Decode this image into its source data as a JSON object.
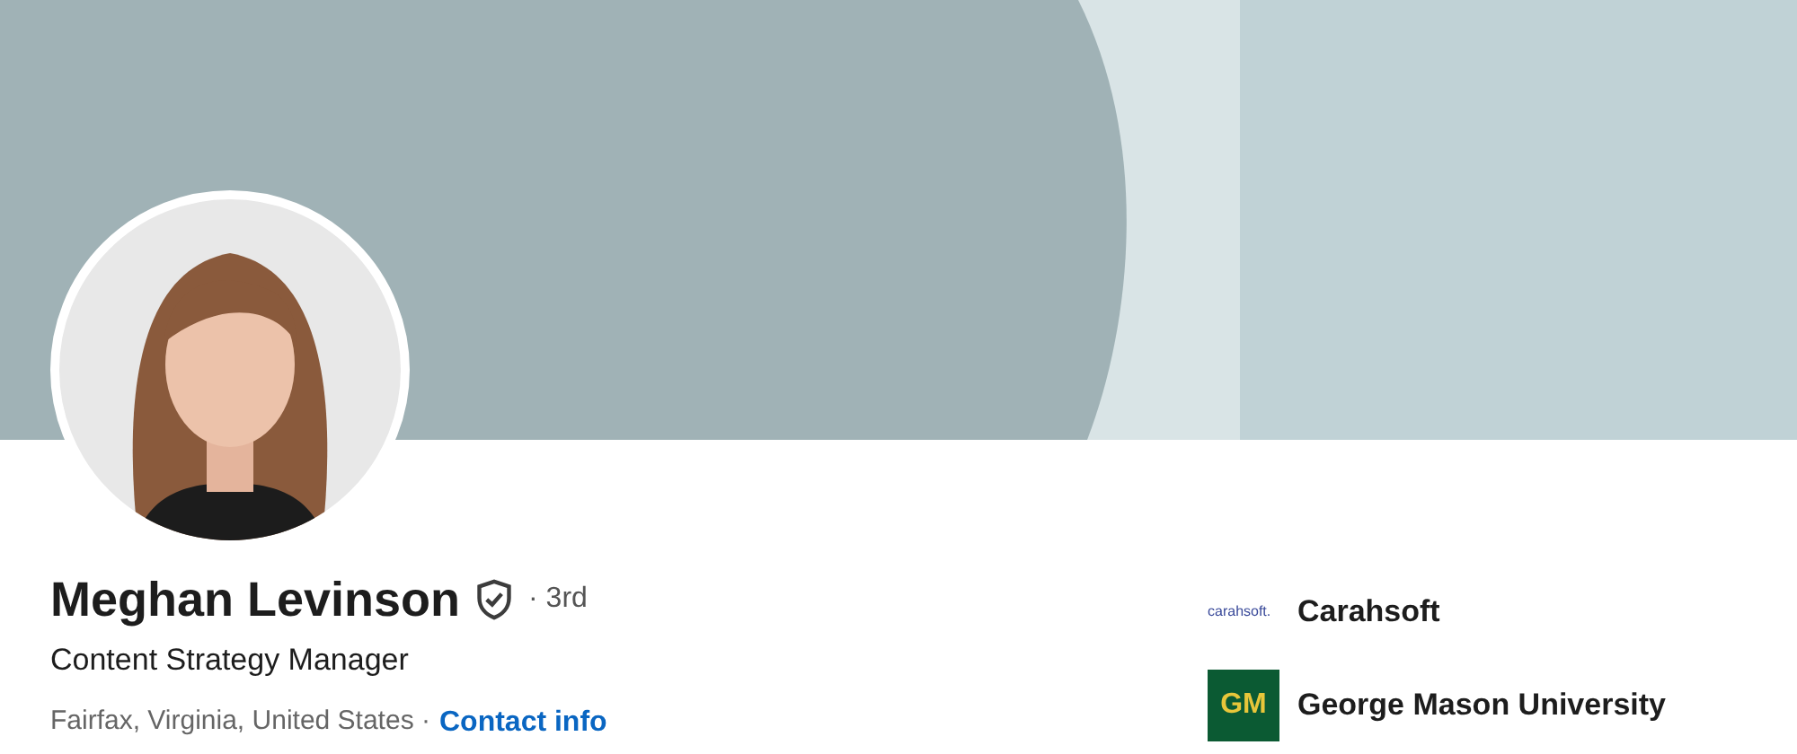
{
  "profile": {
    "name": "Meghan Levinson",
    "verified": true,
    "degree": "· 3rd",
    "headline": "Content Strategy Manager",
    "location": "Fairfax, Virginia, United States ·",
    "contact_link": "Contact info"
  },
  "organizations": [
    {
      "kind": "wordmark",
      "logo_text": "carahsoft.",
      "name": "Carahsoft"
    },
    {
      "kind": "monogram",
      "logo_text": "GM",
      "name": "George Mason University"
    }
  ]
}
